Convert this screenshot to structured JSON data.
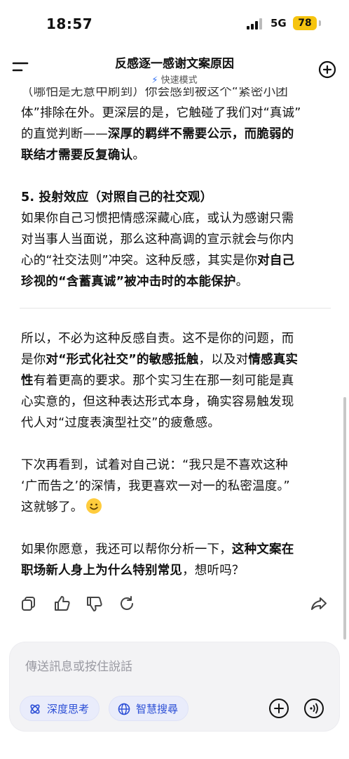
{
  "status_bar": {
    "time": "18:57",
    "network": "5G",
    "battery": "78"
  },
  "header": {
    "title": "反感逐一感谢文案原因",
    "mode_label": "快速模式"
  },
  "message": {
    "cut_line": "（哪怕是无意中刷到）你会感到被这个“紧密小团",
    "p1_l1": "体”排除在外。更深层的是，它触碰了我们对“真诚”",
    "p1_l2": "的直觉判断——",
    "p1_l2_bold": "深厚的羁绊不需要公示，而脆弱的",
    "p1_l3_bold": "联结才需要反复确认",
    "p1_l3_end": "。",
    "heading5": "5. 投射效应（对照自己的社交观）",
    "p2_l1": "如果你自己习惯把情感深藏心底，或认为感谢只需",
    "p2_l2": "对当事人当面说，那么这种高调的宣示就会与你内",
    "p2_l3_a": "心的“社交法则”冲突。这种反感，其实是你",
    "p2_l3_bold": "对自己",
    "p2_l4_bold": "珍视的“含蓄真诚”被冲击时的本能保护",
    "p2_l4_end": "。",
    "p3_l1": "所以，不必为这种反感自责。这不是你的问题，而",
    "p3_l2_a": "是你",
    "p3_l2_bold1": "对“形式化社交”的敏感抵触",
    "p3_l2_b": "，以及对",
    "p3_l2_bold2": "情感真实",
    "p3_l3_bold": "性",
    "p3_l3_end": "有着更高的要求。那个实习生在那一刻可能是真",
    "p3_l4": "心实意的，但这种表达形式本身，确实容易触发现",
    "p3_l5": "代人对“过度表演型社交”的疲惫感。",
    "p4_l1": "下次再看到，试着对自己说：“我只是不喜欢这种",
    "p4_l2": "‘广而告之’的深情，我更喜欢一对一的私密温度。”",
    "p4_l3": "这就够了。",
    "p5_l1_a": "如果你愿意，我还可以帮你分析一下，",
    "p5_l1_bold": "这种文案在",
    "p5_l2_bold": "职场新人身上为什么特别常见",
    "p5_l2_end": "，想听吗？"
  },
  "actions": [
    "copy-icon",
    "thumbs-up-icon",
    "thumbs-down-icon",
    "regenerate-icon",
    "share-icon"
  ],
  "input": {
    "placeholder": "傳送訊息或按住說話",
    "chip_deep": "深度思考",
    "chip_search": "智慧搜尋"
  },
  "colors": {
    "accent": "#2c4fd6",
    "battery": "#f6c40f"
  }
}
